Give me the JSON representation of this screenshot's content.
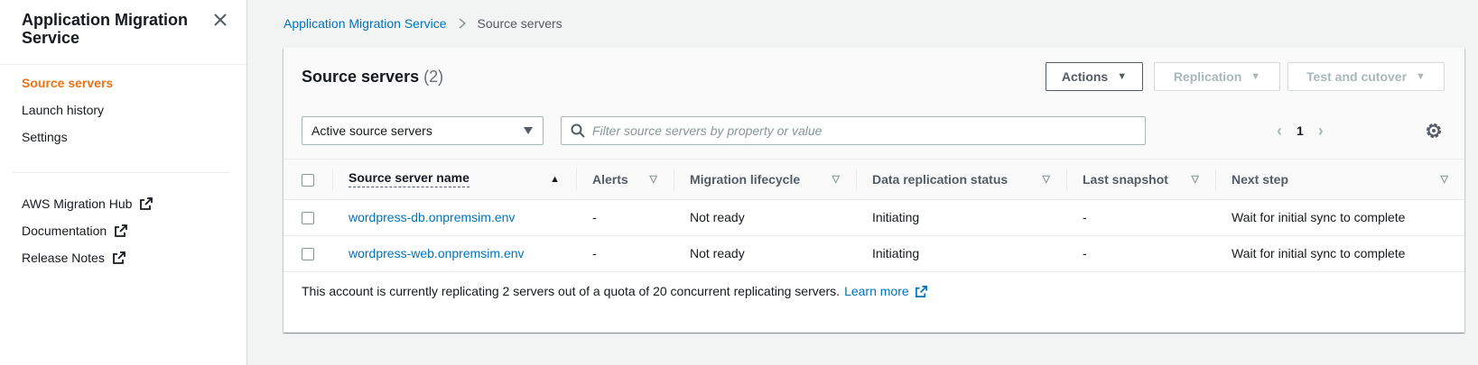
{
  "sidebar": {
    "title": "Application Migration Service",
    "nav_primary": [
      {
        "label": "Source servers",
        "active": true
      },
      {
        "label": "Launch history",
        "active": false
      },
      {
        "label": "Settings",
        "active": false
      }
    ],
    "nav_external": [
      {
        "label": "AWS Migration Hub"
      },
      {
        "label": "Documentation"
      },
      {
        "label": "Release Notes"
      }
    ]
  },
  "breadcrumb": {
    "parent": "Application Migration Service",
    "current": "Source servers"
  },
  "panel": {
    "title": "Source servers",
    "count": "(2)",
    "buttons": {
      "actions": "Actions",
      "replication": "Replication",
      "test_cutover": "Test and cutover"
    },
    "filter_select": "Active source servers",
    "search_placeholder": "Filter source servers by property or value",
    "page": "1"
  },
  "table": {
    "columns": [
      "Source server name",
      "Alerts",
      "Migration lifecycle",
      "Data replication status",
      "Last snapshot",
      "Next step"
    ],
    "rows": [
      {
        "name": "wordpress-db.onpremsim.env",
        "alerts": "-",
        "lifecycle": "Not ready",
        "replication": "Initiating",
        "snapshot": "-",
        "next_step": "Wait for initial sync to complete"
      },
      {
        "name": "wordpress-web.onpremsim.env",
        "alerts": "-",
        "lifecycle": "Not ready",
        "replication": "Initiating",
        "snapshot": "-",
        "next_step": "Wait for initial sync to complete"
      }
    ]
  },
  "footer": {
    "note": "This account is currently replicating 2 servers out of a quota of 20 concurrent replicating servers.",
    "learn_more": "Learn more"
  },
  "colors": {
    "accent_orange": "#ec7211",
    "link_blue": "#0073bb",
    "text_dark": "#16191f"
  }
}
